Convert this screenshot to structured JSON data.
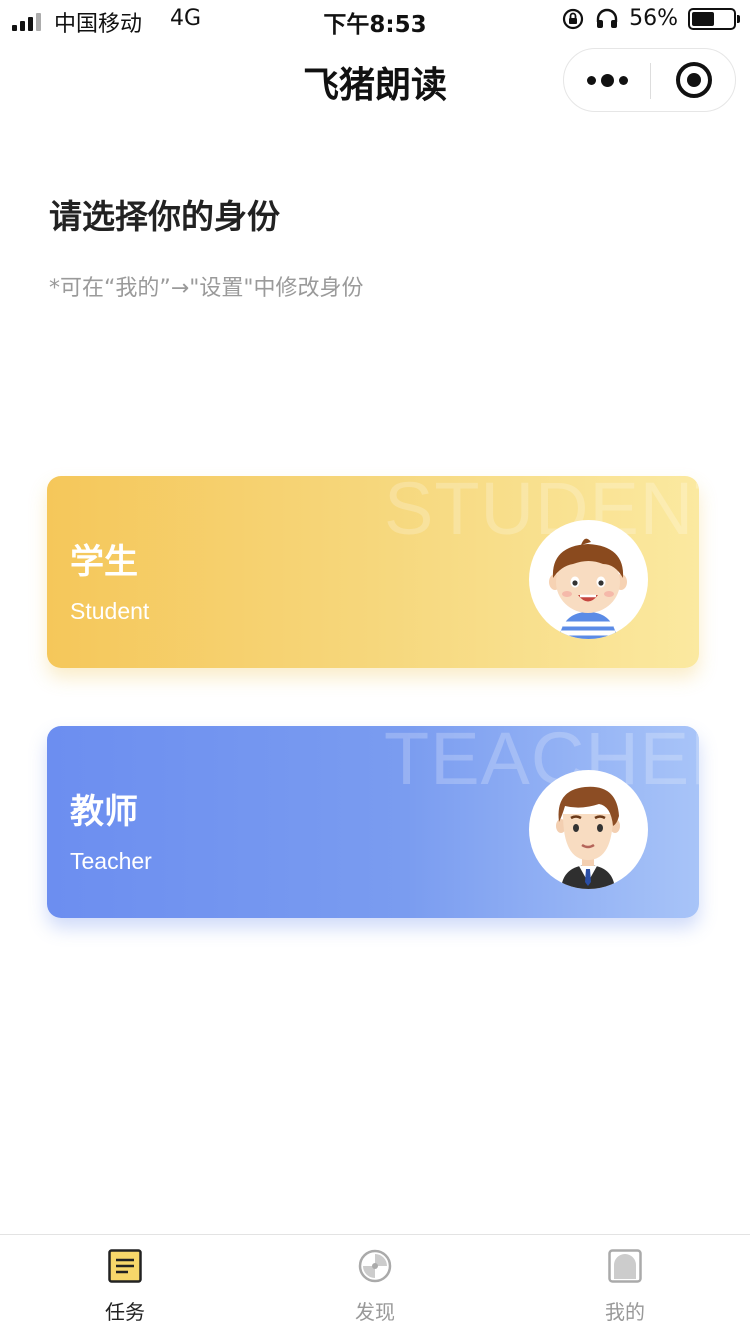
{
  "status_bar": {
    "carrier": "中国移动",
    "network": "4G",
    "time": "下午8:53",
    "battery_percent": "56%",
    "battery_level": 0.56
  },
  "nav": {
    "title": "飞猪朗读"
  },
  "page": {
    "heading": "请选择你的身份",
    "hint": "*可在“我的”→\"设置\"中修改身份"
  },
  "roles": [
    {
      "title": "学生",
      "subtitle": "Student",
      "watermark": "STUDENT",
      "avatar": "student-boy"
    },
    {
      "title": "教师",
      "subtitle": "Teacher",
      "watermark": "TEACHER",
      "avatar": "teacher-man"
    }
  ],
  "tab_bar": {
    "items": [
      {
        "label": "任务",
        "icon": "task-list-icon",
        "active": true
      },
      {
        "label": "发现",
        "icon": "discover-icon",
        "active": false
      },
      {
        "label": "我的",
        "icon": "profile-icon",
        "active": false
      }
    ]
  },
  "colors": {
    "student_card": "#f5c75a",
    "teacher_card": "#6c8ef0",
    "task_icon": "#f7d76a"
  }
}
